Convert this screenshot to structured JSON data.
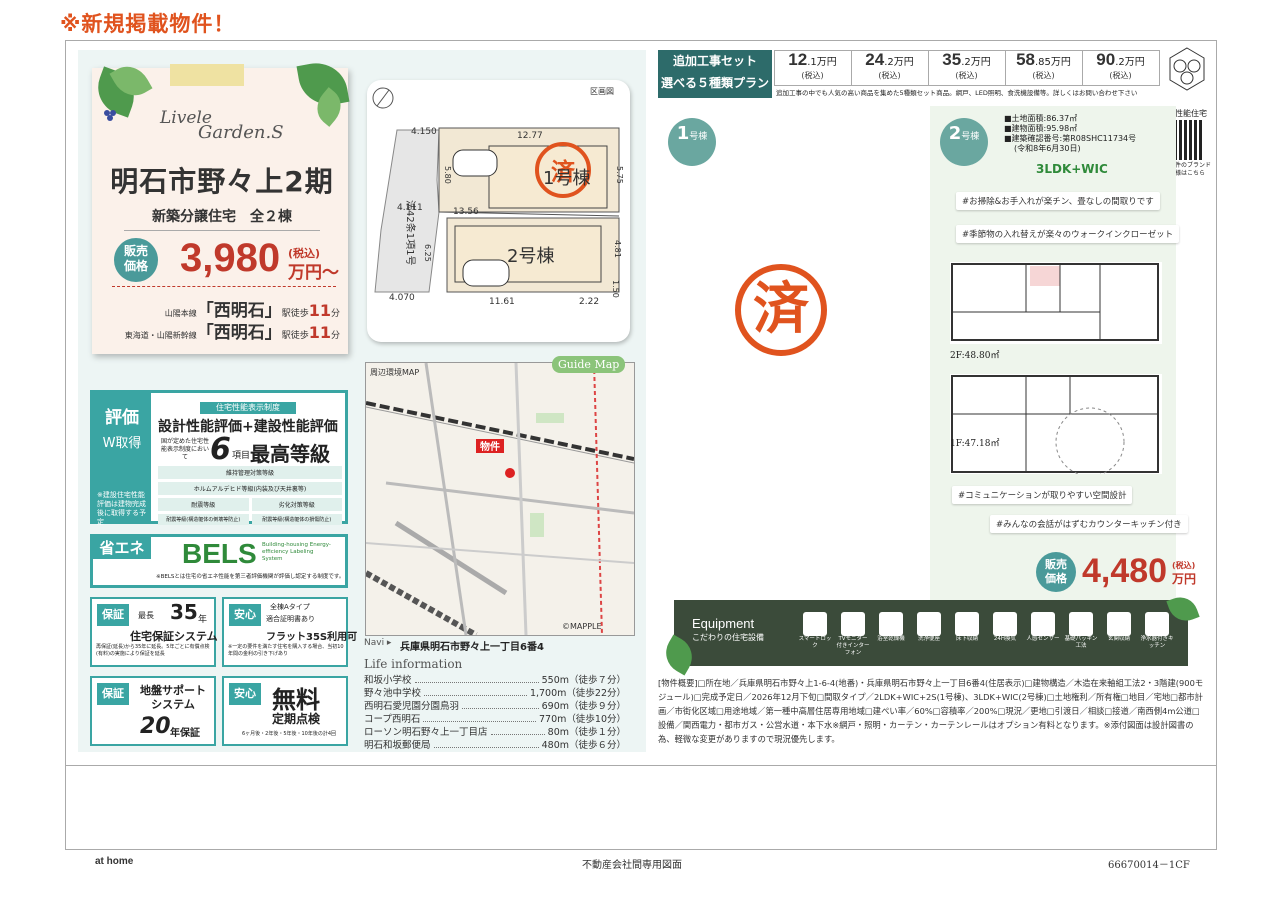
{
  "flag": "※新規掲載物件！",
  "brand": {
    "line1": "Livele",
    "line2": "Garden.S"
  },
  "title": "明石市野々上2期",
  "subtitle": "新築分譲住宅　全２棟",
  "sale_label": [
    "販売",
    "価格"
  ],
  "price": {
    "value": "3,980",
    "tax": "(税込)",
    "unit": "万円〜"
  },
  "stations": [
    {
      "line": "山陽本線",
      "name": "「西明石」",
      "walk": "駅徒歩",
      "mins": "11",
      "unit": "分"
    },
    {
      "line": "東海道・山陽新幹線",
      "name": "「西明石」",
      "walk": "駅徒歩",
      "mins": "11",
      "unit": "分"
    }
  ],
  "siteplan": {
    "label": "区画図",
    "lot1": "1号棟",
    "lot2": "2号棟",
    "road": "法42条1項1号",
    "dims": [
      "4.150",
      "12.77",
      "5.80",
      "5.75",
      "4.111",
      "13.56",
      "6.25",
      "4.81",
      "4.070",
      "11.61",
      "2.22",
      "1.50"
    ],
    "stamp": "済"
  },
  "evaluation": {
    "side": "評価",
    "w": "W取得",
    "side_note": "※建設住宅性能評価は建物完成後に取得する予定",
    "ribbon": "住宅性能表示制度",
    "headline": "設計性能評価+建設性能評価",
    "note": "国が定めた住宅性能表示制度において",
    "six": "6",
    "koumoku": "項目",
    "best": "最高等級",
    "items": [
      "維持管理対策等級",
      "ホルムアルデヒド等級(内装及び天井裏等)",
      "耐震等級",
      "劣化対策等級",
      "耐震等級(構造躯体の倒壊等防止)",
      "耐震等級(構造躯体の損傷防止)"
    ]
  },
  "bels": {
    "side": "省エネ",
    "logo": "BELS",
    "en": "Building-housing Energy-efficiency Labeling System",
    "note": "※BELSとは住宅の省エネ性能を第三者評価機関が評価し認定する制度です。"
  },
  "guarantees": [
    {
      "tag": "保証",
      "small": "最長",
      "big": "35",
      "unit": "年",
      "text": "住宅保証システム",
      "note": "再保証(延長)から35年に延長。5年ごとに有償点検(有料)の実施により保証を延長"
    },
    {
      "tag": "安心",
      "small": "全棟Aタイプ",
      "small2": "適合証明書あり",
      "text": "フラット35S利用可",
      "note": "※一定の要件を満たす住宅を購入する場合、当初10年間の金利の引き下げあり"
    },
    {
      "tag": "保証",
      "text": "地盤サポートシステム",
      "big": "20",
      "unit": "年保証"
    },
    {
      "tag": "安心",
      "big": "無料",
      "text": "定期点検",
      "note": "6ヶ月後・2年後・5年後・10年後の計4回"
    }
  ],
  "map": {
    "label": "周辺環境MAP",
    "guide": "Guide Map",
    "pin": "物件",
    "credit": "©MAPPLE",
    "navi": "Navi ▸",
    "address": "兵庫県明石市野々上一丁目6番4"
  },
  "life": {
    "title": "Life information",
    "items": [
      {
        "name": "和坂小学校",
        "dist": "550m（徒歩７分）"
      },
      {
        "name": "野々池中学校",
        "dist": "1,700m（徒歩22分）"
      },
      {
        "name": "西明石愛児園分園鳥羽",
        "dist": "690m（徒歩９分）"
      },
      {
        "name": "コープ西明石",
        "dist": "770m（徒歩10分）"
      },
      {
        "name": "ローソン明石野々上一丁目店",
        "dist": "80m（徒歩１分）"
      },
      {
        "name": "明石和坂郵便局",
        "dist": "480m（徒歩６分）"
      }
    ]
  },
  "options": {
    "head1": "追加工事セット",
    "head2": "選べる５種類プラン",
    "plans": [
      {
        "int": "12",
        "dec": ".1",
        "unit": "万円",
        "tax": "(税込)"
      },
      {
        "int": "24",
        "dec": ".2",
        "unit": "万円",
        "tax": "(税込)"
      },
      {
        "int": "35",
        "dec": ".2",
        "unit": "万円",
        "tax": "(税込)"
      },
      {
        "int": "58",
        "dec": ".85",
        "unit": "万円",
        "tax": "(税込)"
      },
      {
        "int": "90",
        "dec": ".2",
        "unit": "万円",
        "tax": "(税込)"
      }
    ],
    "note": "追加工事の中でも人気の高い商品を集めた5種類セット商品。網戸、LED照明、食洗機設備等。詳しくはお問い合わせ下さい"
  },
  "high_perf": {
    "label": "高性能住宅",
    "sub": "当物件のブランド仕様はこちら"
  },
  "lot1": {
    "num": "1",
    "label": "号棟",
    "stamp": "済"
  },
  "lot2": {
    "num": "2",
    "label": "号棟",
    "specs": [
      "■土地面積:86.37㎡",
      "■建物面積:95.98㎡",
      "■建築確認番号:第R08SHC11734号",
      "(令和8年6月30日)"
    ],
    "layout": "3LDK+WIC",
    "tags": [
      "#お掃除&お手入れが楽チン、畳なしの間取りです",
      "#季節物の入れ替えが楽々のウォークインクローゼット",
      "#コミュニケーションが取りやすい空間設計",
      "#みんなの会話がはずむカウンターキッチン付き"
    ],
    "floor2": "2F:48.80㎡",
    "floor1": "1F:47.18㎡",
    "sale_label": [
      "販売",
      "価格"
    ],
    "price": "4,480",
    "tax": "(税込)",
    "unit": "万円"
  },
  "equipment": {
    "title": "Equipment",
    "sub": "こだわりの住宅設備",
    "items": [
      "スマートロック",
      "TVモニター付きインターフォン",
      "浴室乾燥機",
      "洗浄便座",
      "床下収納",
      "24H換気",
      "人感センサー",
      "基礎パッキン工法",
      "玄関収納",
      "浄水器付きキッチン"
    ]
  },
  "details": "[物件概要]□所在地／兵庫県明石市野々上1-6-4(地番)・兵庫県明石市野々上一丁目6番4(住居表示)□建物構造／木造在来軸組工法2・3階建(900モジュール)□完成予定日／2026年12月下旬□間取タイプ／2LDK+WIC+2S(1号棟)、3LDK+WIC(2号棟)□土地権利／所有権□地目／宅地□都市計画／市街化区域□用途地域／第一種中高層住居専用地域□建ぺい率／60%□容積率／200%□現況／更地□引渡日／相談□接道／南西側4m公道□設備／関西電力・都市ガス・公営水道・本下水※網戸・照明・カーテン・カーテンレールはオプション有料となります。※添付図面は設計図書の為、軽微な変更がありますので現況優先します。",
  "footer": {
    "left": "at home",
    "center": "不動産会社間専用図面",
    "right": "66670014－1CF"
  }
}
